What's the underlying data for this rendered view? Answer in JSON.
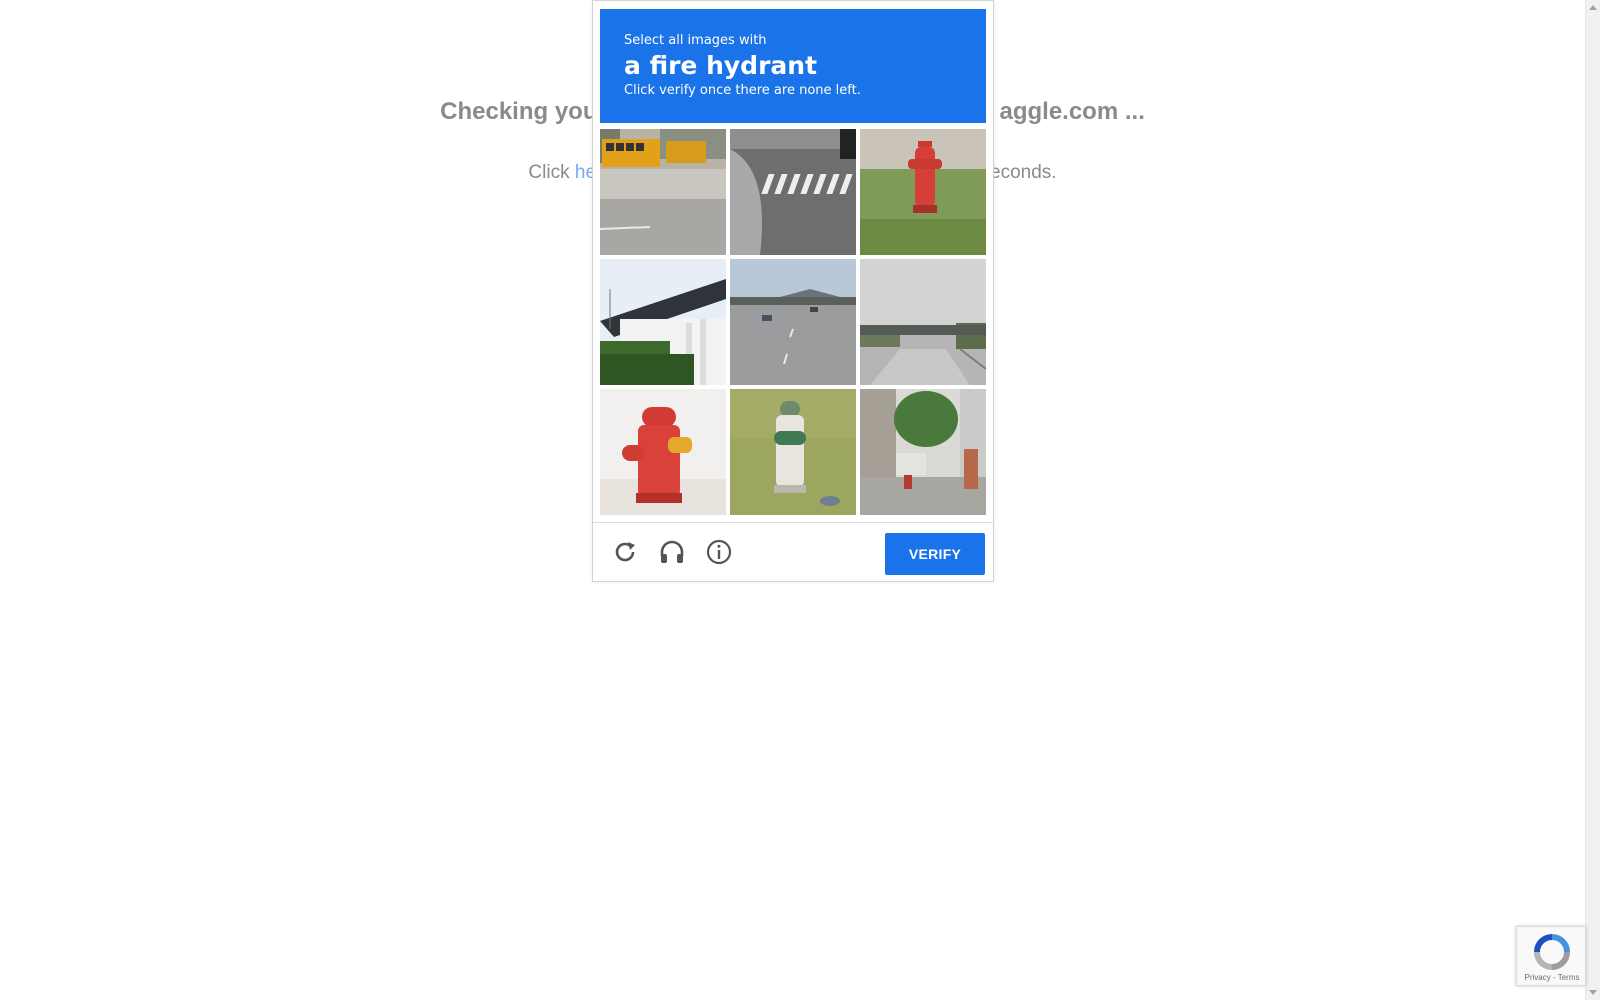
{
  "background": {
    "heading_left": "Checking you",
    "heading_right": "aggle.com ...",
    "sub_prefix": "Click ",
    "sub_link": "he",
    "sub_suffix": "econds."
  },
  "challenge": {
    "instruction": "Select all images with",
    "target": "a fire hydrant",
    "note": "Click verify once there are none left.",
    "tiles": [
      {
        "name": "school-bus"
      },
      {
        "name": "crosswalk"
      },
      {
        "name": "fire-hydrant-red"
      },
      {
        "name": "building-roof"
      },
      {
        "name": "highway"
      },
      {
        "name": "overpass"
      },
      {
        "name": "fire-hydrant-red-closeup"
      },
      {
        "name": "fire-hydrant-green"
      },
      {
        "name": "city-street"
      }
    ],
    "footer": {
      "reload_icon": "reload-icon",
      "audio_icon": "headphones-icon",
      "info_icon": "info-icon",
      "verify_label": "VERIFY"
    },
    "accent_color": "#1a73e8"
  },
  "badge": {
    "links": "Privacy - Terms"
  }
}
